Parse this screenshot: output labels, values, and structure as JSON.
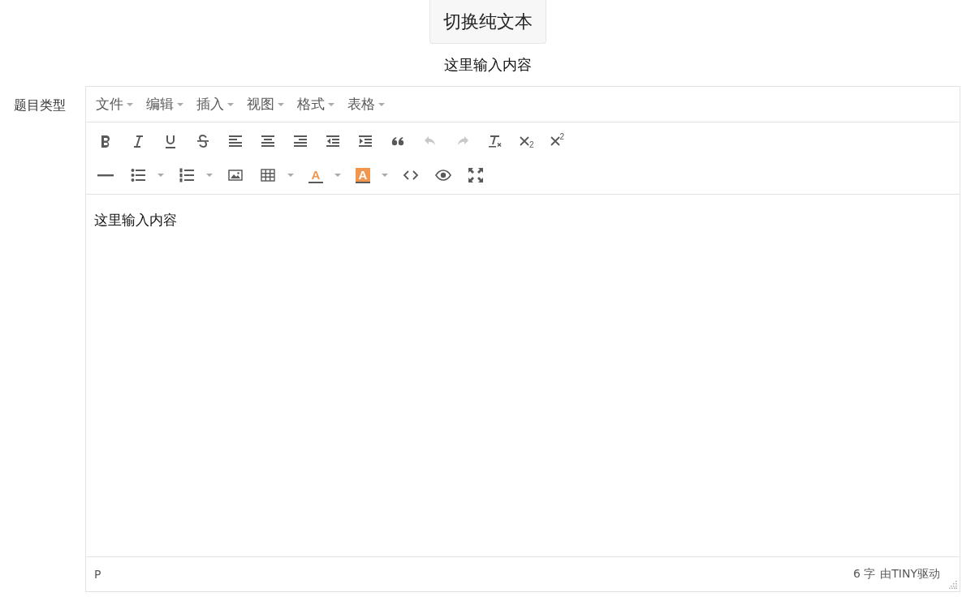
{
  "toggle_button": {
    "label": "切换纯文本"
  },
  "preview_text": "这里输入内容",
  "field_label": "题目类型",
  "editor": {
    "menu": [
      {
        "label": "文件"
      },
      {
        "label": "编辑"
      },
      {
        "label": "插入"
      },
      {
        "label": "视图"
      },
      {
        "label": "格式"
      },
      {
        "label": "表格"
      }
    ],
    "toolbar_rows": [
      [
        {
          "kind": "bold",
          "disabled": false
        },
        {
          "kind": "italic",
          "disabled": false
        },
        {
          "kind": "underline",
          "disabled": false
        },
        {
          "kind": "strikethrough",
          "disabled": false
        },
        {
          "kind": "align-left",
          "disabled": false
        },
        {
          "kind": "align-center",
          "disabled": false
        },
        {
          "kind": "align-right",
          "disabled": false
        },
        {
          "kind": "outdent",
          "disabled": false
        },
        {
          "kind": "indent",
          "disabled": false
        },
        {
          "kind": "blockquote",
          "disabled": false
        },
        {
          "kind": "undo",
          "disabled": true
        },
        {
          "kind": "redo",
          "disabled": true
        },
        {
          "kind": "clear-format",
          "disabled": false
        },
        {
          "kind": "subscript",
          "disabled": false,
          "glyph": "2"
        },
        {
          "kind": "superscript",
          "disabled": false,
          "glyph": "2"
        }
      ],
      [
        {
          "kind": "horizontal-rule",
          "disabled": false
        },
        {
          "kind": "bullet-list",
          "disabled": false,
          "dropdown": true
        },
        {
          "kind": "numbered-list",
          "disabled": false,
          "dropdown": true
        },
        {
          "kind": "image",
          "disabled": false
        },
        {
          "kind": "table",
          "disabled": false,
          "dropdown": true
        },
        {
          "kind": "text-color",
          "disabled": false,
          "dropdown": true,
          "color": "#f0964e",
          "glyph": "A"
        },
        {
          "kind": "background-color",
          "disabled": false,
          "dropdown": true,
          "color": "#f0964e",
          "glyph": "A"
        },
        {
          "kind": "code",
          "disabled": false
        },
        {
          "kind": "preview",
          "disabled": false
        },
        {
          "kind": "fullscreen",
          "disabled": false
        }
      ]
    ],
    "content": "这里输入内容",
    "status_bar": {
      "path": "P",
      "word_count": "6 字",
      "branding": "由TINY驱动"
    }
  }
}
